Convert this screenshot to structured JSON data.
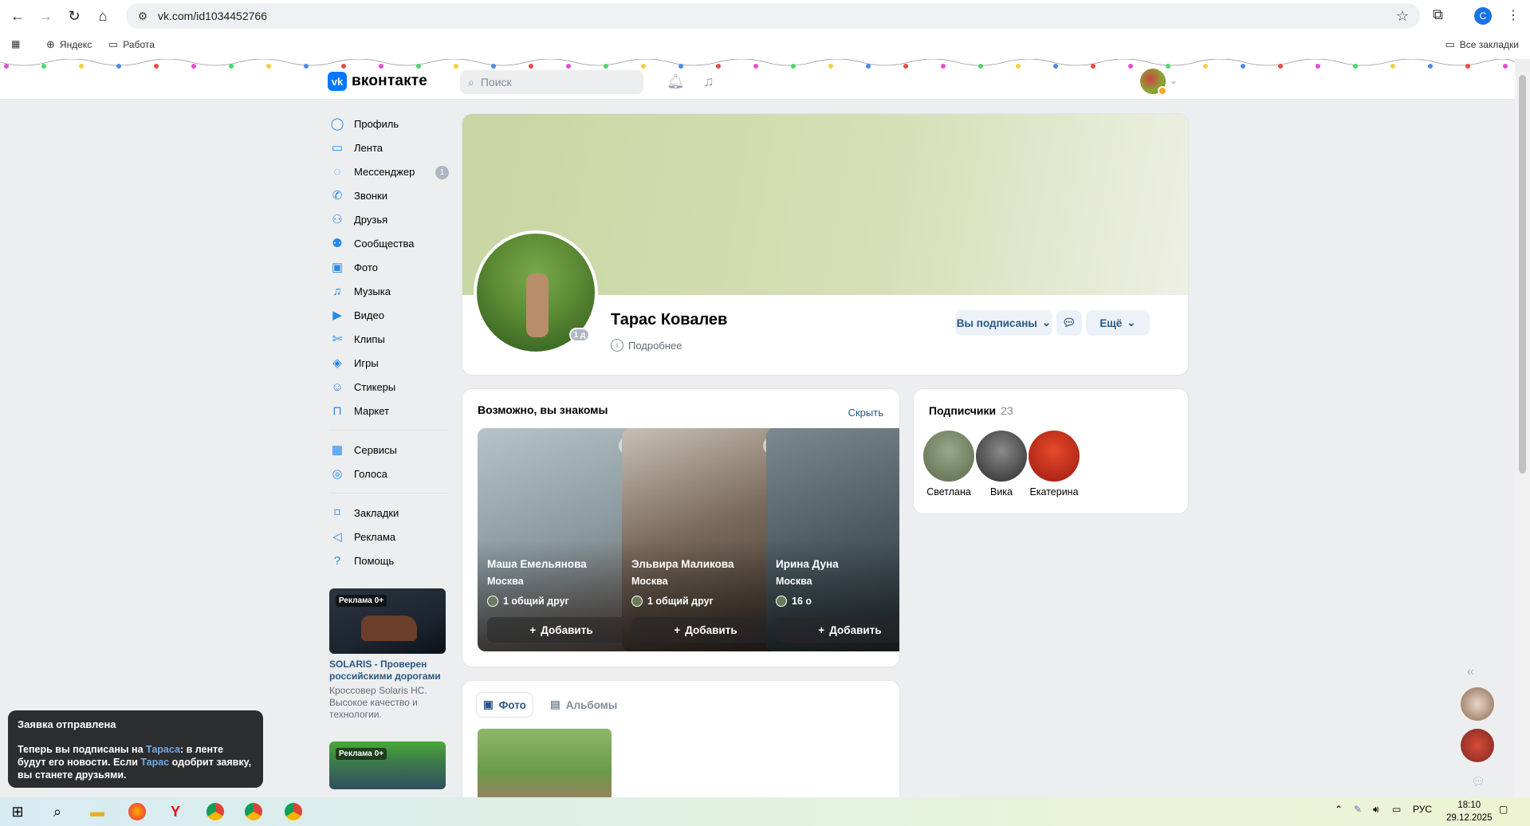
{
  "browser": {
    "url": "vk.com/id1034452766",
    "bookmarks": [
      {
        "label": "Яндекс",
        "icon": "yandex-icon"
      },
      {
        "label": "Работа",
        "icon": "folder-icon"
      }
    ],
    "all_bookmarks": "Все закладки",
    "profile_initial": "C"
  },
  "vk": {
    "logo_text": "вконтакте",
    "search_placeholder": "Поиск",
    "accent": "#0077ff",
    "link_color": "#2a5885"
  },
  "menu": {
    "main": [
      {
        "label": "Профиль",
        "icon": "user-icon"
      },
      {
        "label": "Лента",
        "icon": "feed-icon"
      },
      {
        "label": "Мессенджер",
        "icon": "message-icon",
        "badge": "1"
      },
      {
        "label": "Звонки",
        "icon": "phone-icon"
      },
      {
        "label": "Друзья",
        "icon": "friends-icon"
      },
      {
        "label": "Сообщества",
        "icon": "groups-icon"
      },
      {
        "label": "Фото",
        "icon": "photo-icon"
      },
      {
        "label": "Музыка",
        "icon": "music-icon"
      },
      {
        "label": "Видео",
        "icon": "video-icon"
      },
      {
        "label": "Клипы",
        "icon": "clips-icon"
      },
      {
        "label": "Игры",
        "icon": "games-icon"
      },
      {
        "label": "Стикеры",
        "icon": "stickers-icon"
      },
      {
        "label": "Маркет",
        "icon": "market-icon"
      }
    ],
    "services": [
      {
        "label": "Сервисы",
        "icon": "services-icon"
      },
      {
        "label": "Голоса",
        "icon": "votes-icon"
      }
    ],
    "footer": [
      {
        "label": "Закладки",
        "icon": "bookmark-icon"
      },
      {
        "label": "Реклама",
        "icon": "ads-icon"
      },
      {
        "label": "Помощь",
        "icon": "help-icon"
      }
    ]
  },
  "ads": [
    {
      "tag": "Реклама 0+",
      "title": "SOLARIS - Проверен российскими дорогами",
      "text": "Кроссовер Solaris HC. Высокое качество и технологии."
    },
    {
      "tag": "Реклама 0+"
    }
  ],
  "profile": {
    "name": "Тарас Ковалев",
    "more_label": "Подробнее",
    "last_seen": "1 д",
    "subscribed_label": "Вы подписаны",
    "more_button": "Ещё"
  },
  "suggestions": {
    "title": "Возможно, вы знакомы",
    "hide_label": "Скрыть",
    "add_label": "Добавить",
    "items": [
      {
        "name": "Маша Емельянова",
        "city": "Москва",
        "mutual": "1 общий друг"
      },
      {
        "name": "Эльвира Маликова",
        "city": "Москва",
        "mutual": "1 общий друг"
      },
      {
        "name": "Ирина Дуна",
        "city": "Москва",
        "mutual": "16 о"
      }
    ]
  },
  "subscribers": {
    "title": "Подписчики",
    "count": "23",
    "people": [
      {
        "name": "Светлана"
      },
      {
        "name": "Вика"
      },
      {
        "name": "Екатерина"
      }
    ]
  },
  "photos": {
    "tabs": [
      {
        "label": "Фото"
      },
      {
        "label": "Альбомы"
      }
    ]
  },
  "toast": {
    "title": "Заявка отправлена",
    "line1_pre": "Теперь вы подписаны на ",
    "line1_link": "Тараса",
    "line1_post": ": в ленте будут его новости. Если ",
    "line2_link": "Тарас",
    "line2_post": " одобрит заявку, вы станете друзьями."
  },
  "taskbar": {
    "lang": "РУС",
    "time": "18:10",
    "date": "29.12.2025"
  }
}
